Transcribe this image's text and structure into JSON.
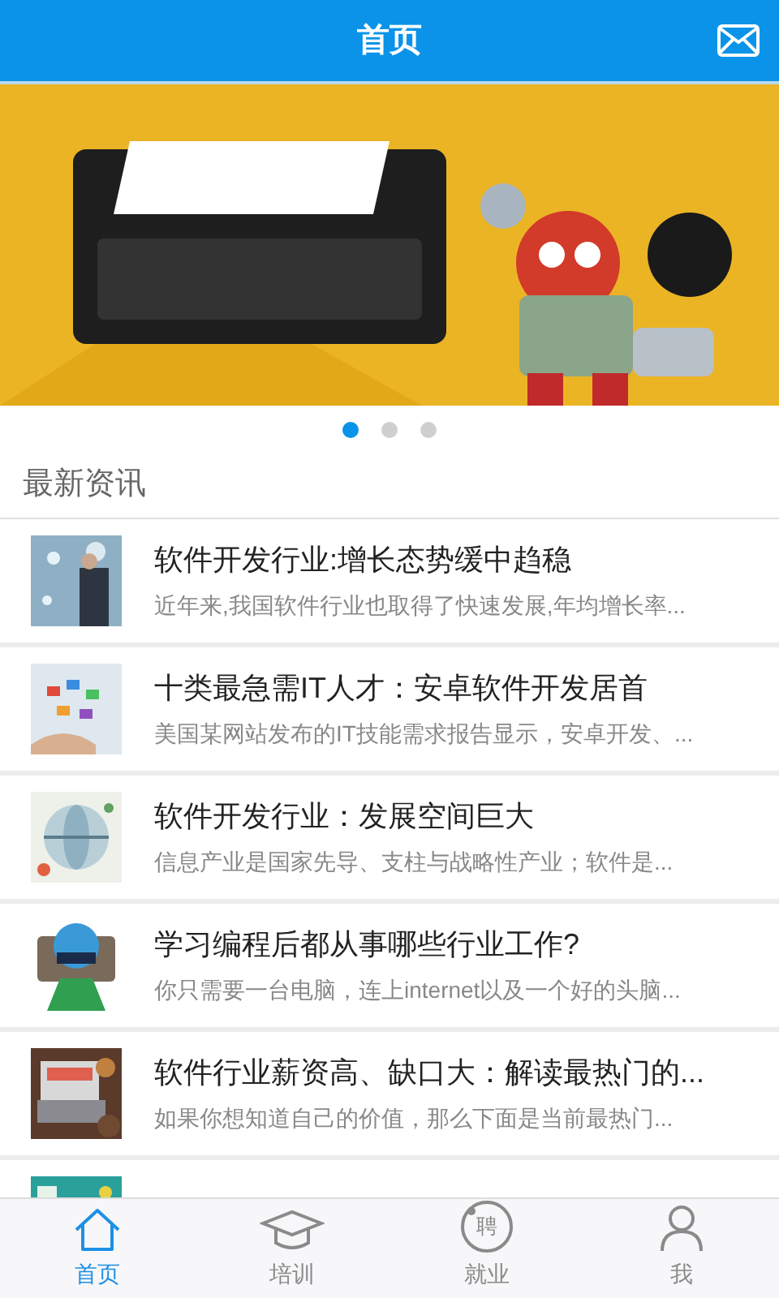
{
  "header": {
    "title": "首页"
  },
  "carousel": {
    "dots": [
      {
        "selected": true
      },
      {
        "selected": false
      },
      {
        "selected": false
      }
    ]
  },
  "section": {
    "title": "最新资讯"
  },
  "news": [
    {
      "title": "软件开发行业:增长态势缓中趋稳",
      "summary": "近年来,我国软件行业也取得了快速发展,年均增长率..."
    },
    {
      "title": "十类最急需IT人才：安卓软件开发居首",
      "summary": "美国某网站发布的IT技能需求报告显示，安卓开发、..."
    },
    {
      "title": "软件开发行业：发展空间巨大",
      "summary": "信息产业是国家先导、支柱与战略性产业；软件是..."
    },
    {
      "title": "学习编程后都从事哪些行业工作?",
      "summary": "你只需要一台电脑，连上internet以及一个好的头脑..."
    },
    {
      "title": "软件行业薪资高、缺口大：解读最热门的...",
      "summary": "如果你想知道自己的价值，那么下面是当前最热门..."
    }
  ],
  "tabbar": [
    {
      "kind": "home",
      "label": "首页",
      "selected": true
    },
    {
      "kind": "training",
      "label": "培训",
      "selected": false
    },
    {
      "kind": "jobs",
      "label": "就业",
      "glyph": "聘",
      "selected": false
    },
    {
      "kind": "me",
      "label": "我",
      "selected": false
    }
  ]
}
